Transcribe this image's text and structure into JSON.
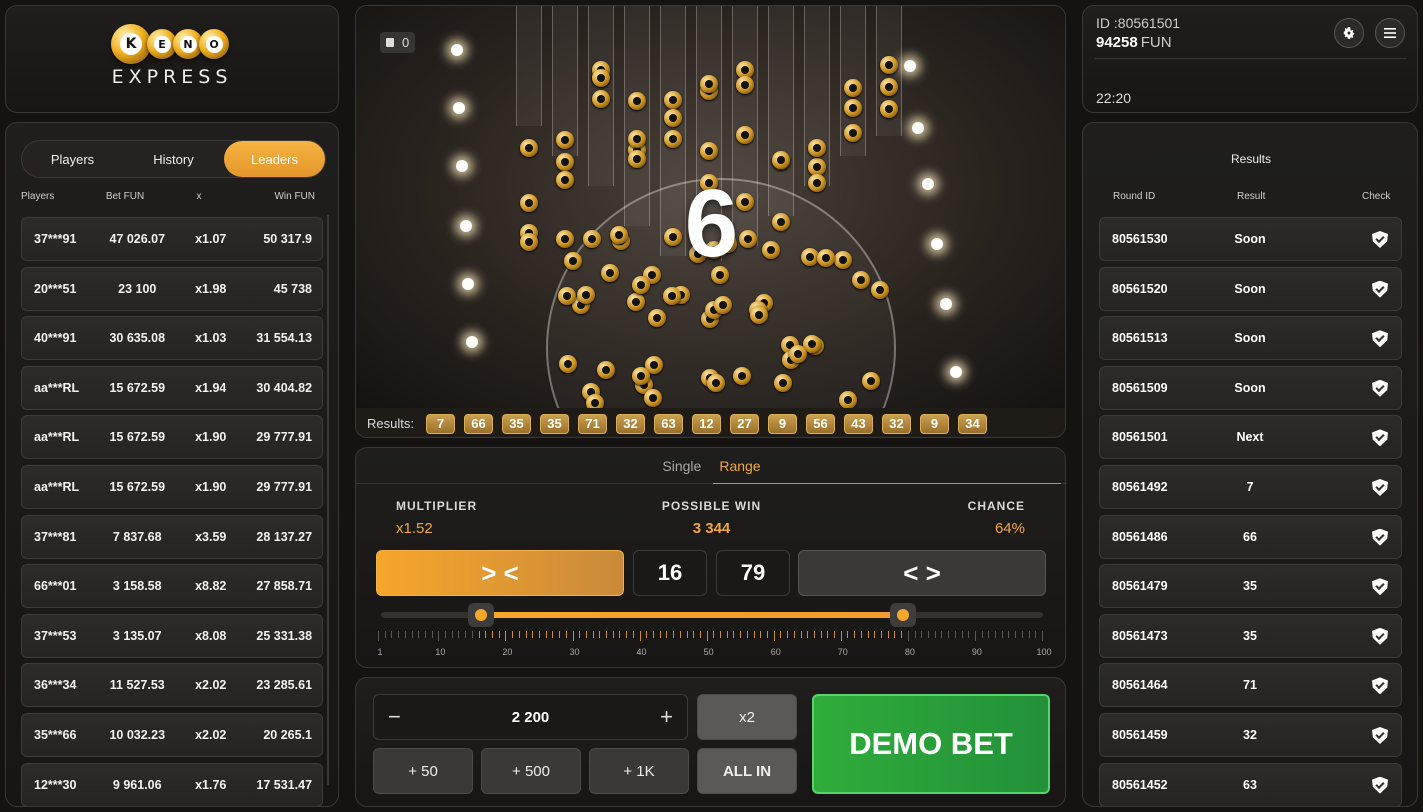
{
  "logo": {
    "letters": [
      "K",
      "E",
      "N",
      "O"
    ],
    "express": "EXPRESS"
  },
  "players": {
    "tabs": [
      {
        "label": "Players",
        "active": false
      },
      {
        "label": "History",
        "active": false
      },
      {
        "label": "Leaders",
        "active": true
      }
    ],
    "columns": [
      "Players",
      "Bet FUN",
      "x",
      "Win FUN"
    ],
    "rows": [
      {
        "player": "37***91",
        "bet": "47 026.07",
        "x": "x1.07",
        "win": "50 317.9"
      },
      {
        "player": "20***51",
        "bet": "23 100",
        "x": "x1.98",
        "win": "45 738"
      },
      {
        "player": "40***91",
        "bet": "30 635.08",
        "x": "x1.03",
        "win": "31 554.13"
      },
      {
        "player": "aa***RL",
        "bet": "15 672.59",
        "x": "x1.94",
        "win": "30 404.82"
      },
      {
        "player": "aa***RL",
        "bet": "15 672.59",
        "x": "x1.90",
        "win": "29 777.91"
      },
      {
        "player": "aa***RL",
        "bet": "15 672.59",
        "x": "x1.90",
        "win": "29 777.91"
      },
      {
        "player": "37***81",
        "bet": "7 837.68",
        "x": "x3.59",
        "win": "28 137.27"
      },
      {
        "player": "66***01",
        "bet": "3 158.58",
        "x": "x8.82",
        "win": "27 858.71"
      },
      {
        "player": "37***53",
        "bet": "3 135.07",
        "x": "x8.08",
        "win": "25 331.38"
      },
      {
        "player": "36***34",
        "bet": "11 527.53",
        "x": "x2.02",
        "win": "23 285.61"
      },
      {
        "player": "35***66",
        "bet": "10 032.23",
        "x": "x2.02",
        "win": "20 265.1"
      },
      {
        "player": "12***30",
        "bet": "9 961.06",
        "x": "x1.76",
        "win": "17 531.47"
      }
    ]
  },
  "video": {
    "ticket_count": "0",
    "current_number": "6",
    "results_label": "Results:",
    "results": [
      "7",
      "66",
      "35",
      "35",
      "71",
      "32",
      "63",
      "12",
      "27",
      "9",
      "56",
      "43",
      "32",
      "9",
      "34"
    ]
  },
  "range": {
    "tabs": {
      "single": "Single",
      "range": "Range"
    },
    "multiplier_label": "MULTIPLIER",
    "multiplier": "x1.52",
    "possible_win_label": "POSSIBLE WIN",
    "possible_win": "3 344",
    "chance_label": "CHANCE",
    "chance": "64%",
    "inner_symbol": "> <",
    "outer_symbol": "< >",
    "from": "16",
    "to": "79",
    "slider": {
      "min": 1,
      "max": 100,
      "low": 16,
      "high": 79
    },
    "tick_labels": [
      "1",
      "10",
      "20",
      "30",
      "40",
      "50",
      "60",
      "70",
      "80",
      "90",
      "100"
    ]
  },
  "bet": {
    "minus": "−",
    "plus": "+",
    "amount": "2 200",
    "x2": "x2",
    "p50": "+ 50",
    "p500": "+ 500",
    "p1k": "+ 1K",
    "all_in": "ALL IN",
    "demo_bet": "DEMO BET"
  },
  "account": {
    "id": "ID :80561501",
    "balance": "94258",
    "currency": "FUN",
    "time": "22:20"
  },
  "results_table": {
    "title": "Results",
    "columns": [
      "Round ID",
      "Result",
      "Check"
    ],
    "rows": [
      {
        "id": "80561530",
        "result": "Soon"
      },
      {
        "id": "80561520",
        "result": "Soon"
      },
      {
        "id": "80561513",
        "result": "Soon"
      },
      {
        "id": "80561509",
        "result": "Soon"
      },
      {
        "id": "80561501",
        "result": "Next"
      },
      {
        "id": "80561492",
        "result": "7"
      },
      {
        "id": "80561486",
        "result": "66"
      },
      {
        "id": "80561479",
        "result": "35"
      },
      {
        "id": "80561473",
        "result": "35"
      },
      {
        "id": "80561464",
        "result": "71"
      },
      {
        "id": "80561459",
        "result": "32"
      },
      {
        "id": "80561452",
        "result": "63"
      }
    ]
  },
  "colors": {
    "accent": "#f6a62b",
    "demo_bet": "#2fad3a",
    "panel": "#1f1e1c"
  },
  "icons": {
    "settings": "gear-icon",
    "menu": "menu-icon",
    "check": "shield-check-icon",
    "ticket": "ticket-icon"
  }
}
